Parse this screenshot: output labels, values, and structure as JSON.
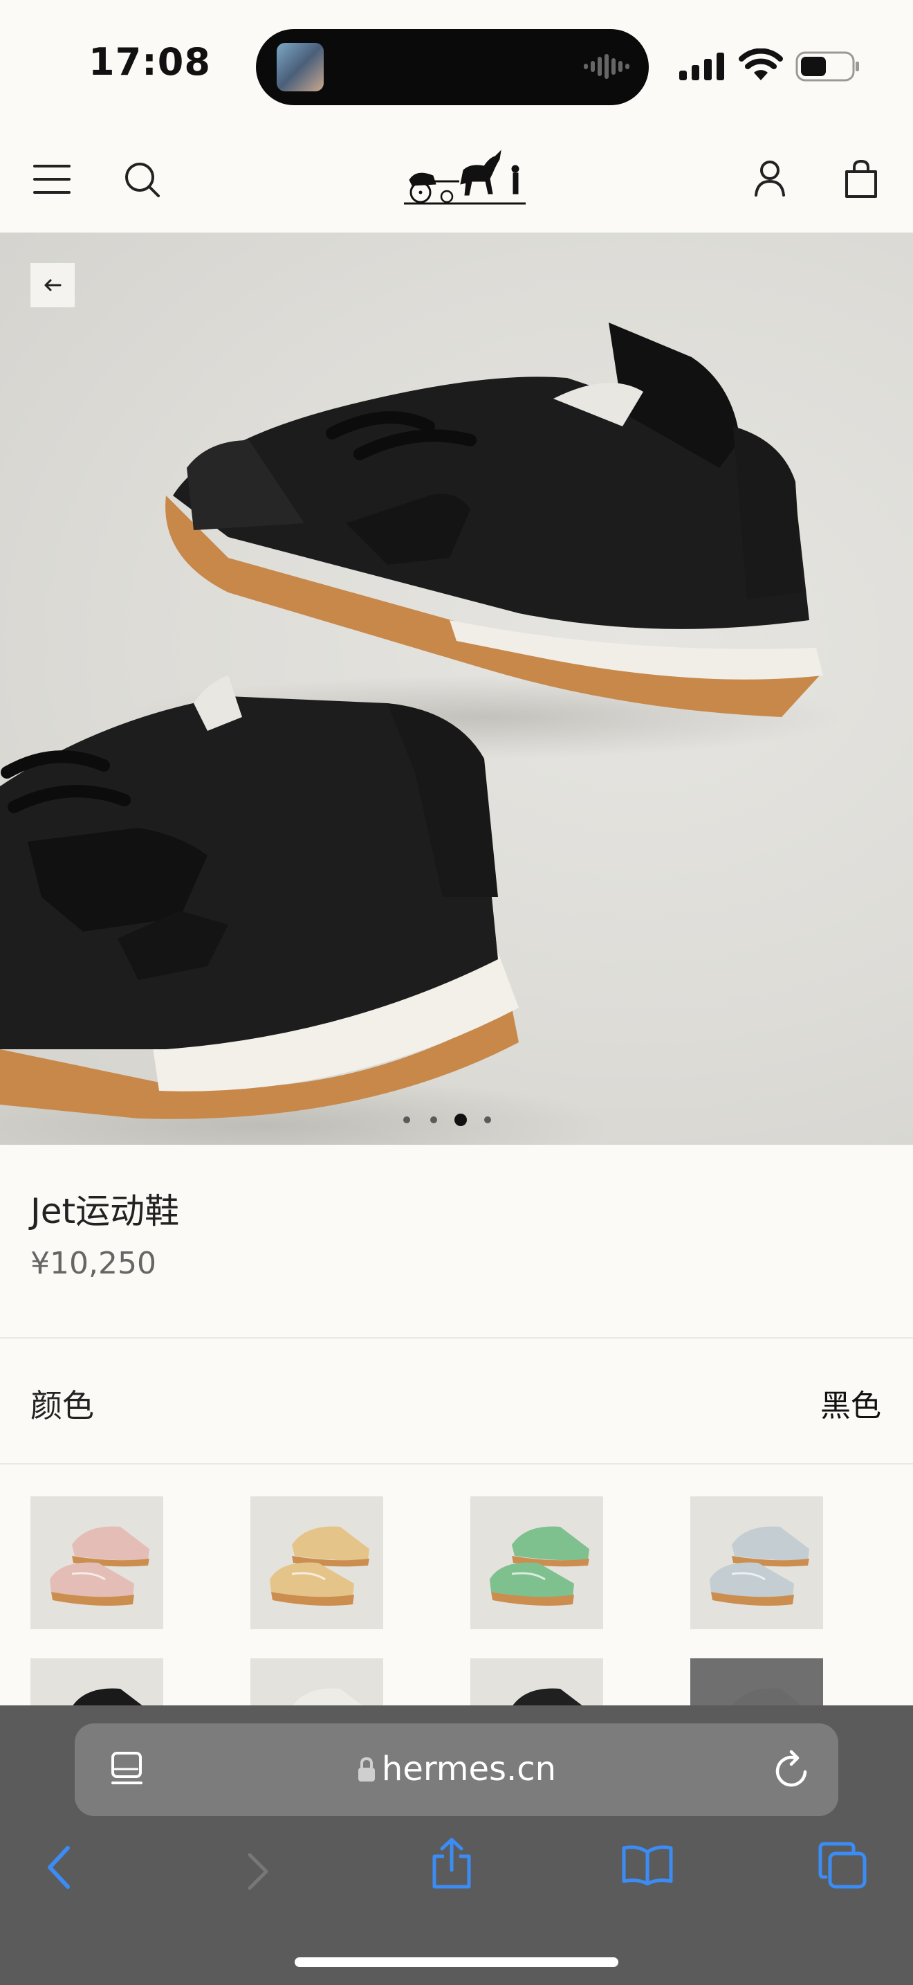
{
  "status_bar": {
    "time": "17:08"
  },
  "header": {
    "menu_icon": "hamburger-menu-icon",
    "search_icon": "search-icon",
    "logo": "hermes-carriage-logo",
    "account_icon": "user-icon",
    "bag_icon": "shopping-bag-icon"
  },
  "gallery": {
    "back_icon": "arrow-left-icon",
    "image_count": 4,
    "active_index": 2
  },
  "product": {
    "name": "Jet运动鞋",
    "price": "¥10,250"
  },
  "color": {
    "label": "颜色",
    "selected": "黑色",
    "swatches": [
      {
        "name": "pink",
        "upper": "#e3bdb6",
        "sole": "#cb8e4f"
      },
      {
        "name": "beige",
        "upper": "#e5c48a",
        "sole": "#cb8e4f"
      },
      {
        "name": "green",
        "upper": "#7fc08f",
        "sole": "#cb8e4f"
      },
      {
        "name": "grey-blue",
        "upper": "#c3cdd2",
        "sole": "#cb8e4f"
      },
      {
        "name": "black",
        "upper": "#1a1a1a",
        "sole": "#f2f0ea"
      },
      {
        "name": "white",
        "upper": "#eeece7",
        "sole": "#f2f0ea"
      },
      {
        "name": "black-dark",
        "upper": "#202020",
        "sole": "#e8e6e0"
      },
      {
        "name": "grey-dark",
        "upper": "#6a6a6a",
        "sole": "#777777"
      }
    ]
  },
  "browser": {
    "url": "hermes.cn",
    "reader_icon": "reader-mode-icon",
    "lock_icon": "lock-icon",
    "reload_icon": "reload-icon",
    "toolbar": [
      "back-icon",
      "forward-icon",
      "share-icon",
      "bookmarks-icon",
      "tabs-icon"
    ]
  }
}
